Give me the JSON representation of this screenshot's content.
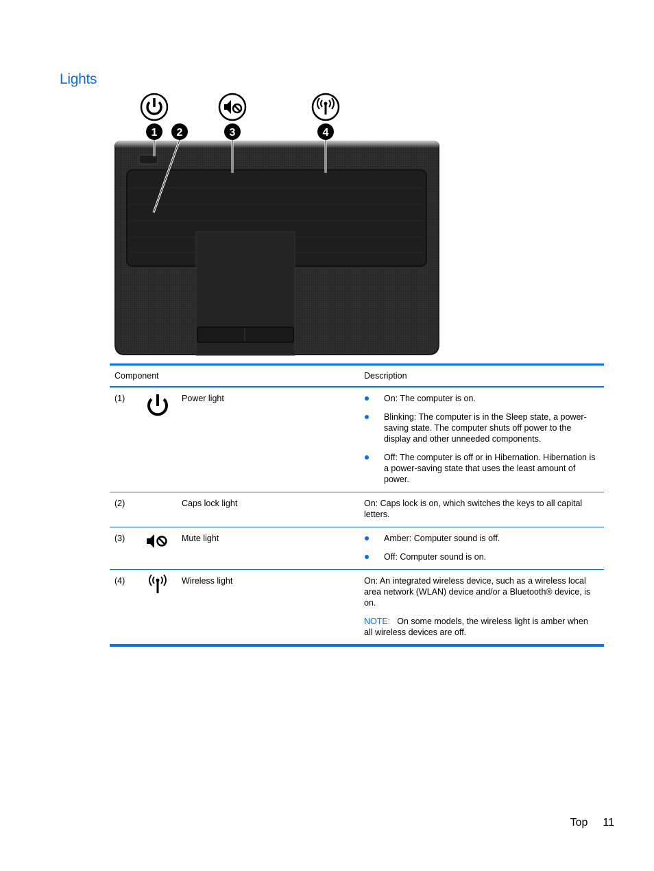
{
  "page": {
    "title": "Lights",
    "footer": {
      "section": "Top",
      "page_number": "11"
    }
  },
  "figure": {
    "alt": "Top view of laptop showing locations of lights",
    "callouts": [
      {
        "number": "1",
        "icon": "power-icon"
      },
      {
        "number": "2",
        "icon": "none"
      },
      {
        "number": "3",
        "icon": "mute-icon"
      },
      {
        "number": "4",
        "icon": "wireless-icon"
      }
    ]
  },
  "table": {
    "headers": {
      "component": "Component",
      "description": "Description"
    },
    "rows": [
      {
        "num": "(1)",
        "icon": "power-icon",
        "name": "Power light",
        "bullets": [
          "On: The computer is on.",
          "Blinking: The computer is in the Sleep state, a power-saving state. The computer shuts off power to the display and other unneeded components.",
          "Off: The computer is off or in Hibernation. Hibernation is a power-saving state that uses the least amount of power."
        ]
      },
      {
        "num": "(2)",
        "icon": "",
        "name": "Caps lock light",
        "text": "On: Caps lock is on, which switches the keys to all capital letters."
      },
      {
        "num": "(3)",
        "icon": "mute-icon",
        "name": "Mute light",
        "bullets": [
          "Amber: Computer sound is off.",
          "Off: Computer sound is on."
        ]
      },
      {
        "num": "(4)",
        "icon": "wireless-icon",
        "name": "Wireless light",
        "text": "On: An integrated wireless device, such as a wireless local area network (WLAN) device and/or a Bluetooth® device, is on.",
        "note_label": "NOTE:",
        "note_text": "On some models, the wireless light is amber when all wireless devices are off."
      }
    ]
  },
  "colors": {
    "accent": "#0a6ee8",
    "text": "#000000",
    "laptop_body": "#262626"
  }
}
